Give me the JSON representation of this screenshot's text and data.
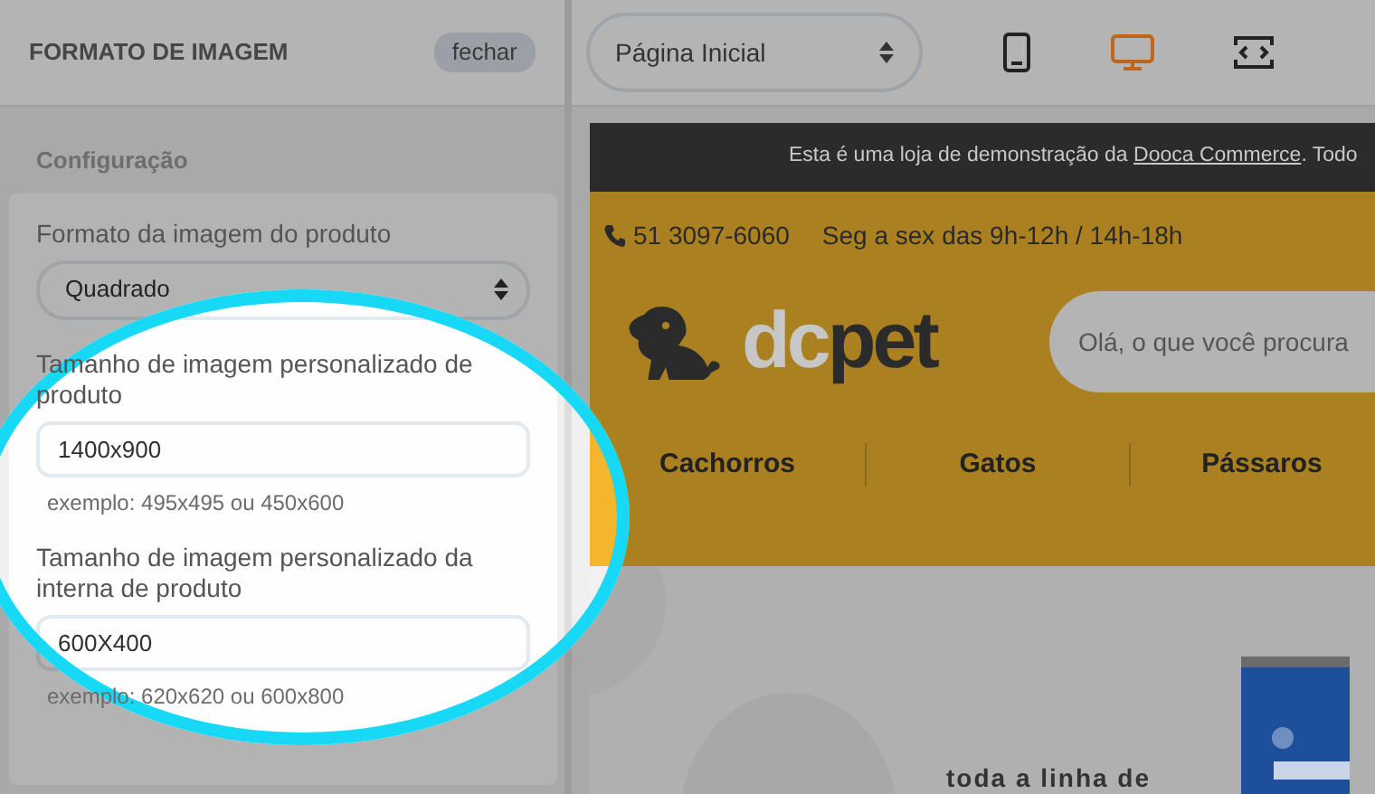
{
  "panel": {
    "title": "FORMATO DE IMAGEM",
    "close_button": "fechar",
    "section": "Configuração",
    "fields": [
      {
        "kind": "select",
        "label": "Formato da imagem do produto",
        "value": "Quadrado"
      },
      {
        "kind": "text",
        "label": "Tamanho de imagem personalizado de produto",
        "value": "1400x900",
        "hint": "exemplo: 495x495 ou 450x600"
      },
      {
        "kind": "text",
        "label": "Tamanho de imagem personalizado da interna de produto",
        "value": "600X400",
        "hint": "exemplo: 620x620 ou 600x800"
      }
    ]
  },
  "toolbar": {
    "page_select": "Página Inicial",
    "devices": [
      {
        "kind": "mobile",
        "selected": false
      },
      {
        "kind": "desktop",
        "selected": true
      },
      {
        "kind": "fullscreen",
        "selected": false
      }
    ]
  },
  "preview": {
    "notice": "Esta é uma loja de demonstração da",
    "notice_link": "Dooca Commerce",
    "notice_tail": ". Todo",
    "phone": "51 3097-6060",
    "hours": "Seg a sex das 9h-12h / 14h-18h",
    "logo": {
      "part_1": "dc",
      "part_2": "pet"
    },
    "search": {
      "placeholder": "Olá, o que você procura"
    },
    "nav": [
      "Cachorros",
      "Gatos",
      "Pássaros"
    ],
    "hero_text": "toda a linha de"
  },
  "highlight": {
    "kind": "ellipse"
  }
}
